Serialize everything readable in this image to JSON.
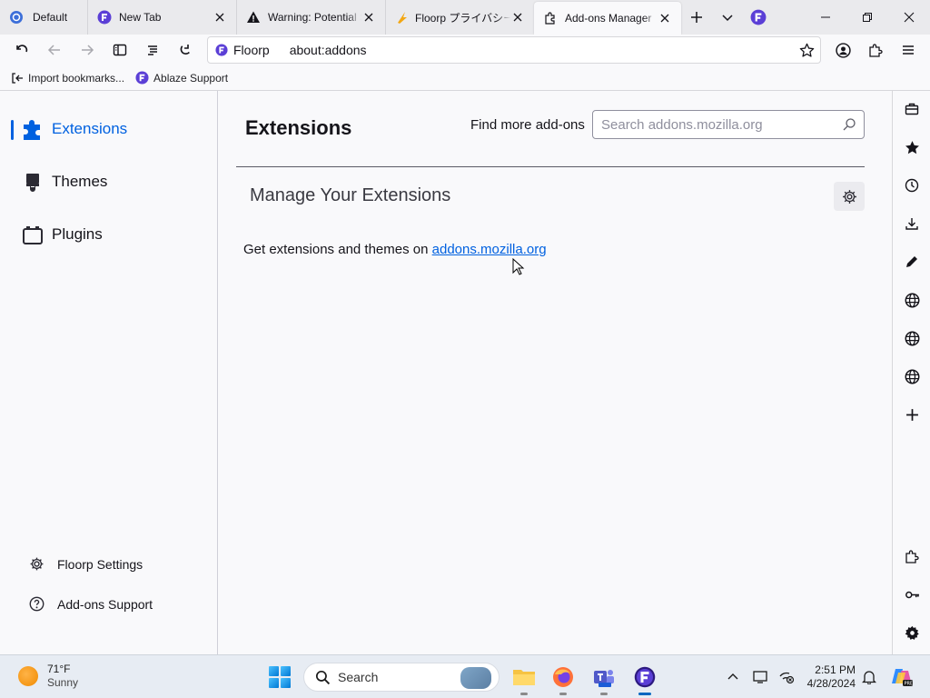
{
  "browser": {
    "workspace_label": "Default",
    "tabs": [
      {
        "title": "New Tab",
        "icon": "floorp-icon"
      },
      {
        "title": "Warning: Potential Security Risk Ahead",
        "icon": "warning-icon"
      },
      {
        "title": "Floorp プライバシーポリシー",
        "icon": "floorp-orange-icon"
      },
      {
        "title": "Add-ons Manager",
        "icon": "puzzle-icon",
        "active": true
      }
    ],
    "url_identity": "Floorp",
    "url": "about:addons"
  },
  "bookmarks": [
    {
      "label": "Import bookmarks...",
      "icon": "import-icon"
    },
    {
      "label": "Ablaze Support",
      "icon": "floorp-icon"
    }
  ],
  "categories": [
    {
      "label": "Extensions",
      "icon": "puzzle-icon",
      "selected": true
    },
    {
      "label": "Themes",
      "icon": "brush-icon"
    },
    {
      "label": "Plugins",
      "icon": "plugin-icon"
    }
  ],
  "footer": {
    "settings": "Floorp Settings",
    "support": "Add-ons Support"
  },
  "main": {
    "heading": "Extensions",
    "find_more": "Find more add-ons",
    "search_placeholder": "Search addons.mozilla.org",
    "section_title": "Manage Your Extensions",
    "empty_text": "Get extensions and themes on ",
    "empty_link": "addons.mozilla.org"
  },
  "colors": {
    "accent": "#0061e0",
    "floorp": "#5b3fd6"
  },
  "taskbar": {
    "weather_temp": "71°F",
    "weather_cond": "Sunny",
    "search_label": "Search",
    "time": "2:51 PM",
    "date": "4/28/2024"
  }
}
